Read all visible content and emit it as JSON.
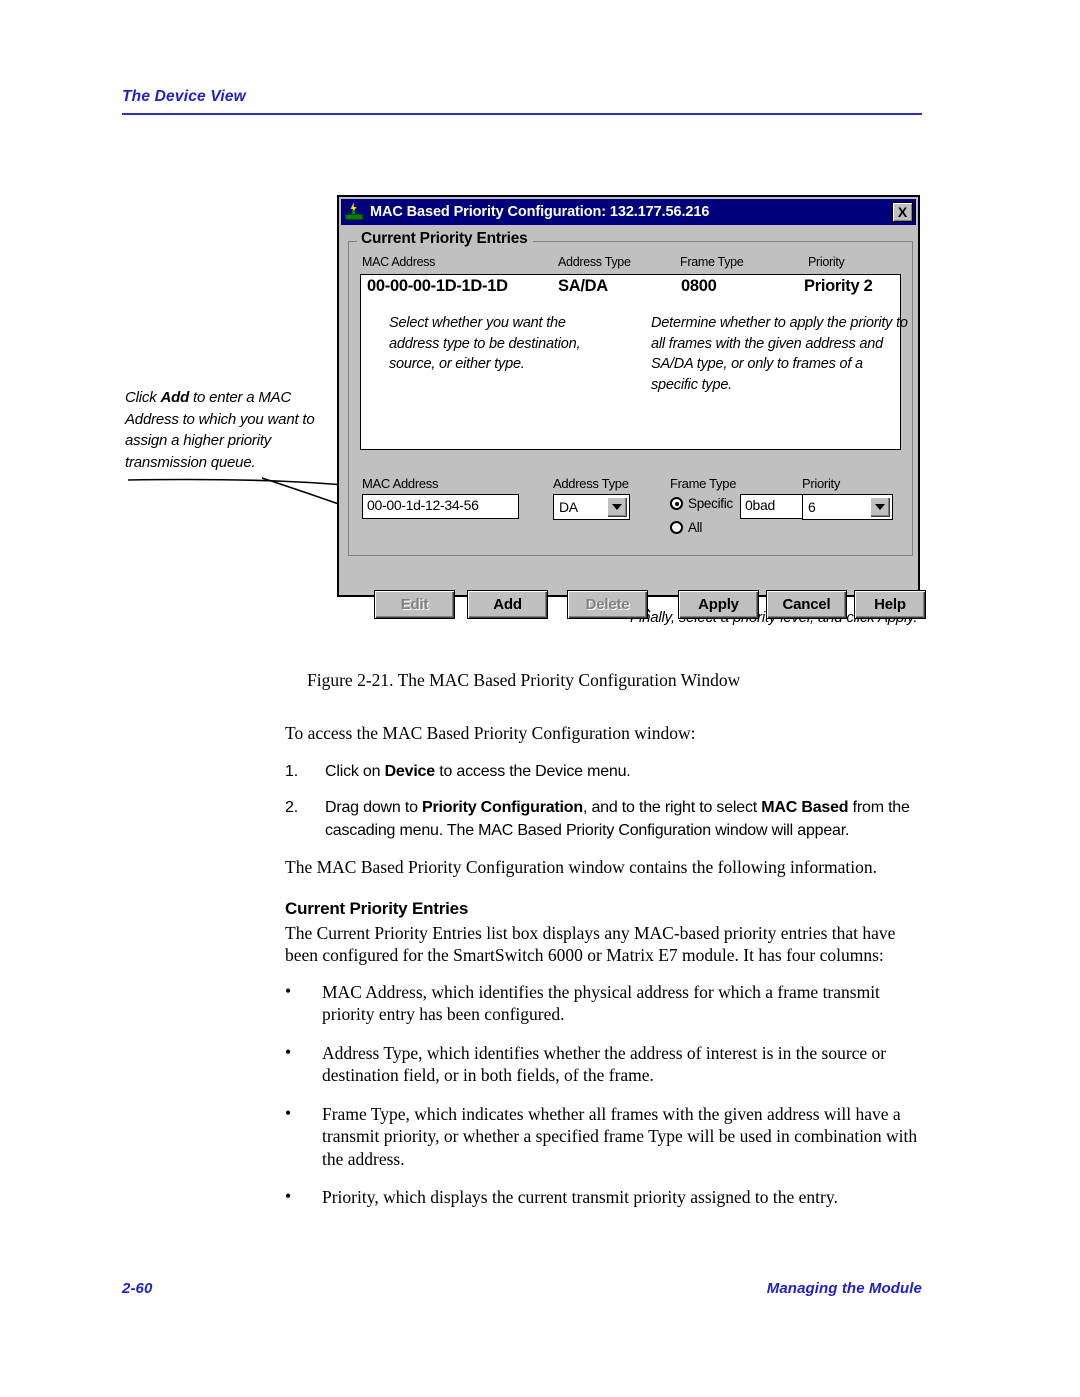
{
  "header": {
    "running_title": "The Device View"
  },
  "figure": {
    "caption": "Figure 2-21.  The MAC Based Priority Configuration Window",
    "dialog": {
      "title": "MAC Based Priority Configuration: 132.177.56.216",
      "icon": "device-bolt-icon",
      "close_label": "X",
      "group_title": "Current Priority Entries",
      "list_columns": [
        "MAC Address",
        "Address Type",
        "Frame Type",
        "Priority"
      ],
      "list_rows": [
        {
          "mac_address": "00-00-00-1D-1D-1D",
          "address_type": "SA/DA",
          "frame_type": "0800",
          "priority": "Priority 2"
        }
      ],
      "field_labels": {
        "mac_address": "MAC Address",
        "address_type": "Address Type",
        "frame_type": "Frame Type",
        "priority": "Priority"
      },
      "fields": {
        "mac_address_value": "00-00-1d-12-34-56",
        "address_type_value": "DA",
        "frame_type_specific_label": "Specific",
        "frame_type_specific_value": "0bad",
        "frame_type_all_label": "All",
        "frame_type_selected": "Specific",
        "priority_value": "6"
      },
      "buttons": [
        {
          "label": "Edit",
          "disabled": true
        },
        {
          "label": "Add",
          "disabled": false
        },
        {
          "label": "Delete",
          "disabled": true
        },
        {
          "label": "Apply",
          "disabled": false
        },
        {
          "label": "Cancel",
          "disabled": false
        },
        {
          "label": "Help",
          "disabled": false
        }
      ]
    },
    "callouts": {
      "left": {
        "line1": "Click ",
        "bold": "Add",
        "line2": " to enter a MAC Address to which you want to assign a higher priority transmission queue."
      },
      "address_type": "Select whether you want the address type to be destination, source, or either type.",
      "frame_type": "Determine whether to apply the priority to all frames with the given address and SA/DA type, or only to frames of a specific type.",
      "priority": "Finally, select a priority level, and click Apply."
    }
  },
  "body": {
    "intro": "To access the MAC Based Priority Configuration window:",
    "steps": [
      {
        "num": "1.",
        "pre": "Click on ",
        "bold": "Device",
        "post": " to access the Device menu."
      },
      {
        "num": "2.",
        "pre": "Drag down to ",
        "bold": "Priority Configuration",
        "mid": ", and to the right to select ",
        "bold2": "MAC Based",
        "post": " from the cascading menu. The MAC Based Priority Configuration window will appear."
      }
    ],
    "contains_line": "The MAC Based Priority Configuration window contains the following information.",
    "subhead": "Current Priority Entries",
    "subhead_para": "The Current Priority Entries list box displays any MAC-based priority entries that have been configured for the SmartSwitch 6000 or Matrix E7 module. It has four columns:",
    "bullets": [
      "MAC Address, which identifies the physical address for which a frame transmit priority entry has been configured.",
      "Address Type, which identifies whether the address of interest is in the source or destination field, or in both fields, of the frame.",
      "Frame Type, which indicates whether all frames with the given address will have a transmit priority, or whether a specified frame Type will be used in combination with the address.",
      "Priority, which displays the current transmit priority assigned to the entry."
    ],
    "bullet_glyph": "•"
  },
  "footer": {
    "page_number": "2-60",
    "section": "Managing the Module"
  }
}
